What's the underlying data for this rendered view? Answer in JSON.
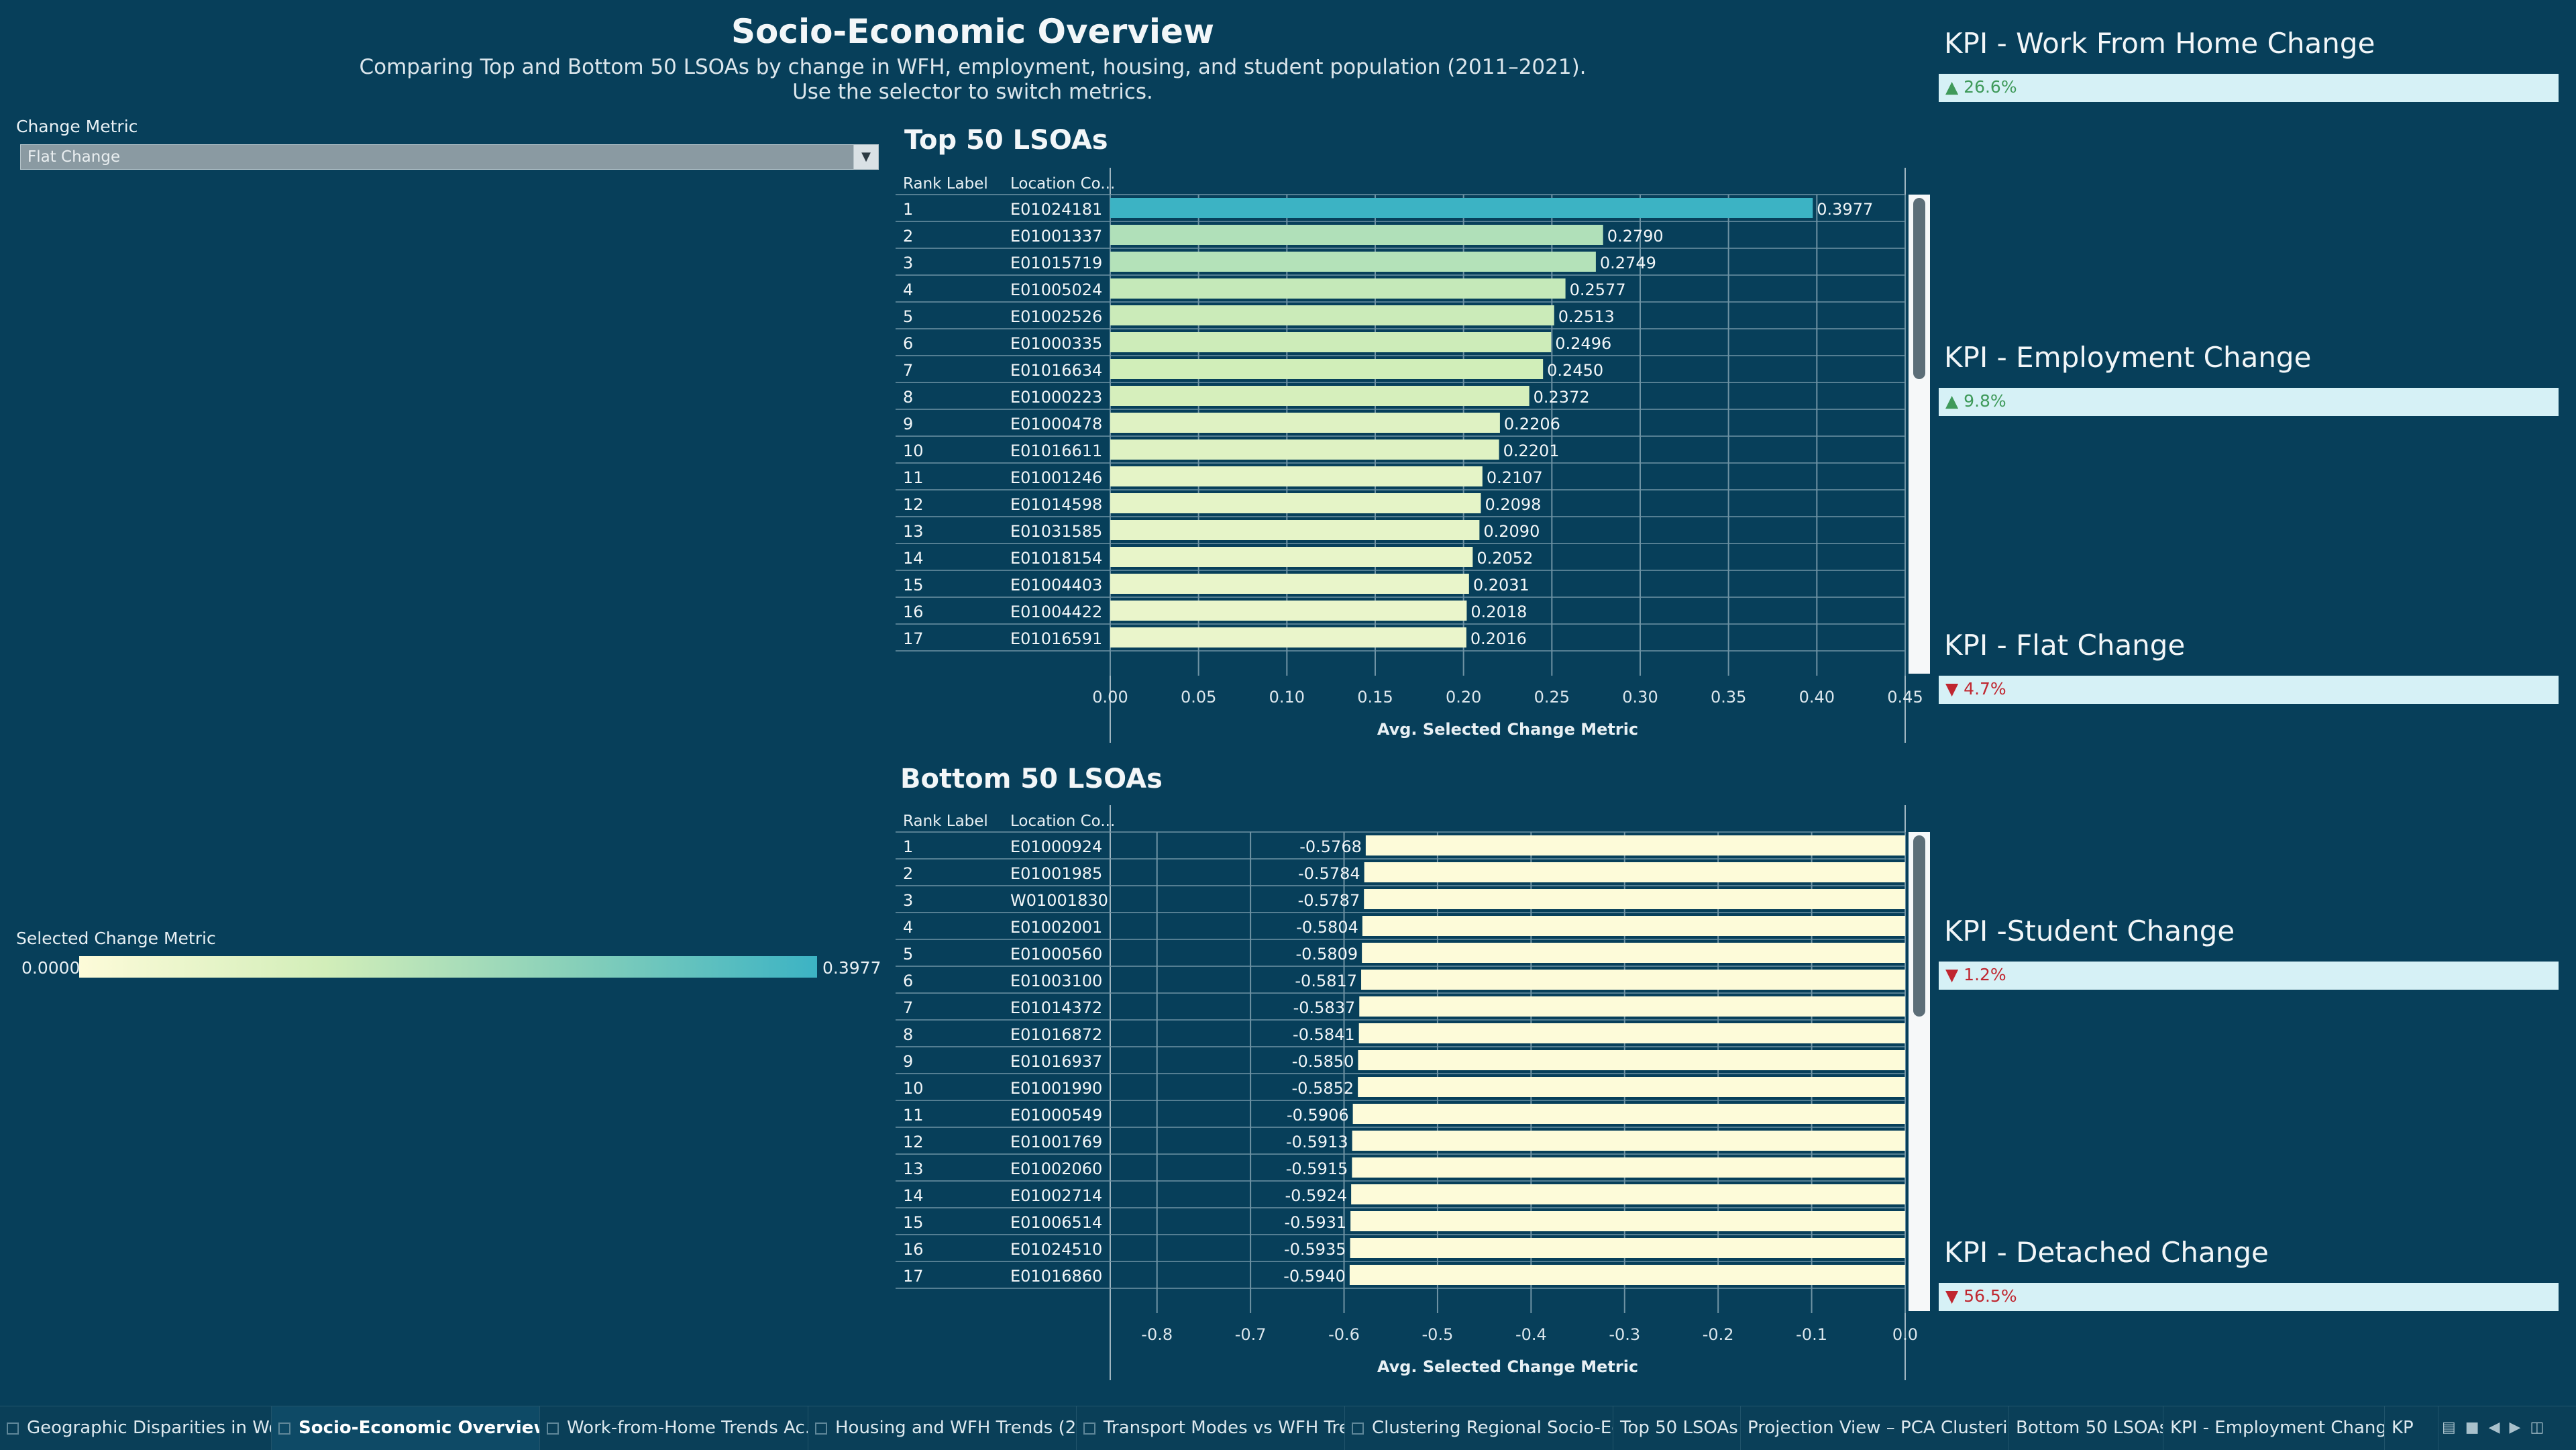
{
  "header": {
    "title": "Socio-Economic Overview",
    "subtitle_line1": "Comparing Top and Bottom 50 LSOAs by change in WFH, employment, housing, and student population (2011–2021).",
    "subtitle_line2": "Use the selector to switch metrics."
  },
  "filter": {
    "label": "Change Metric",
    "selected": "Flat Change"
  },
  "color_legend": {
    "title": "Selected Change Metric",
    "min_label": "0.0000",
    "max_label": "0.3977"
  },
  "top_section": {
    "title": "Top 50 LSOAs"
  },
  "bottom_section": {
    "title": "Bottom 50 LSOAs"
  },
  "table_headers": {
    "rank": "Rank Label",
    "location": "Location Co..."
  },
  "kpis": [
    {
      "title": "KPI - Work From Home Change",
      "value": "▲ 26.6%",
      "direction": "up"
    },
    {
      "title": "KPI - Employment Change",
      "value": "▲ 9.8%",
      "direction": "up"
    },
    {
      "title": "KPI - Flat Change",
      "value": "▼ 4.7%",
      "direction": "down"
    },
    {
      "title": "KPI -Student Change",
      "value": "▼ 1.2%",
      "direction": "down"
    },
    {
      "title": "KPI - Detached Change",
      "value": "▼ 56.5%",
      "direction": "down"
    }
  ],
  "tabs": [
    "Geographic Disparities in Wo...",
    "Socio-Economic Overview (...",
    "Work-from-Home Trends Ac...",
    "Housing and WFH Trends (2...",
    "Transport Modes vs WFH Tre...",
    "Clustering Regional Socio-Ec...",
    "Top 50 LSOAs",
    "Projection View – PCA Clusterin...",
    "Bottom 50 LSOAs",
    "KPI - Employment Change",
    "KP"
  ],
  "active_tab": 1,
  "colors": {
    "background": "#073f5a",
    "gradient_low": "#fdfbd9",
    "gradient_high": "#3cb3c4",
    "kpi_box": "#d6f1f6",
    "kpi_up": "#3f9a5a",
    "kpi_down": "#c0262f"
  },
  "chart_data": [
    {
      "type": "bar",
      "orientation": "horizontal",
      "title": "Top 50 LSOAs",
      "xlabel": "Avg. Selected Change Metric",
      "xlim": [
        0,
        0.45
      ],
      "xticks": [
        "0.00",
        "0.05",
        "0.10",
        "0.15",
        "0.20",
        "0.25",
        "0.30",
        "0.35",
        "0.40",
        "0.45"
      ],
      "ranks": [
        "1",
        "2",
        "3",
        "4",
        "5",
        "6",
        "7",
        "8",
        "9",
        "10",
        "11",
        "12",
        "13",
        "14",
        "15",
        "16",
        "17"
      ],
      "categories": [
        "E01024181",
        "E01001337",
        "E01015719",
        "E01005024",
        "E01002526",
        "E01000335",
        "E01016634",
        "E01000223",
        "E01000478",
        "E01016611",
        "E01001246",
        "E01014598",
        "E01031585",
        "E01018154",
        "E01004403",
        "E01004422",
        "E01016591"
      ],
      "values": [
        0.3977,
        0.279,
        0.2749,
        0.2577,
        0.2513,
        0.2496,
        0.245,
        0.2372,
        0.2206,
        0.2201,
        0.2107,
        0.2098,
        0.209,
        0.2052,
        0.2031,
        0.2018,
        0.2016
      ],
      "labels": [
        "0.3977",
        "0.2790",
        "0.2749",
        "0.2577",
        "0.2513",
        "0.2496",
        "0.2450",
        "0.2372",
        "0.2206",
        "0.2201",
        "0.2107",
        "0.2098",
        "0.2090",
        "0.2052",
        "0.2031",
        "0.2018",
        "0.2016"
      ],
      "grid": true
    },
    {
      "type": "bar",
      "orientation": "horizontal",
      "title": "Bottom 50 LSOAs",
      "xlabel": "Avg. Selected Change Metric",
      "xlim": [
        -0.85,
        0
      ],
      "xticks": [
        "-0.8",
        "-0.7",
        "-0.6",
        "-0.5",
        "-0.4",
        "-0.3",
        "-0.2",
        "-0.1",
        "0.0"
      ],
      "ranks": [
        "1",
        "2",
        "3",
        "4",
        "5",
        "6",
        "7",
        "8",
        "9",
        "10",
        "11",
        "12",
        "13",
        "14",
        "15",
        "16",
        "17"
      ],
      "categories": [
        "E01000924",
        "E01001985",
        "W01001830",
        "E01002001",
        "E01000560",
        "E01003100",
        "E01014372",
        "E01016872",
        "E01016937",
        "E01001990",
        "E01000549",
        "E01001769",
        "E01002060",
        "E01002714",
        "E01006514",
        "E01024510",
        "E01016860"
      ],
      "values": [
        -0.5768,
        -0.5784,
        -0.5787,
        -0.5804,
        -0.5809,
        -0.5817,
        -0.5837,
        -0.5841,
        -0.585,
        -0.5852,
        -0.5906,
        -0.5913,
        -0.5915,
        -0.5924,
        -0.5931,
        -0.5935,
        -0.594
      ],
      "labels": [
        "-0.5768",
        "-0.5784",
        "-0.5787",
        "-0.5804",
        "-0.5809",
        "-0.5817",
        "-0.5837",
        "-0.5841",
        "-0.5850",
        "-0.5852",
        "-0.5906",
        "-0.5913",
        "-0.5915",
        "-0.5924",
        "-0.5931",
        "-0.5935",
        "-0.5940"
      ],
      "grid": true
    }
  ]
}
